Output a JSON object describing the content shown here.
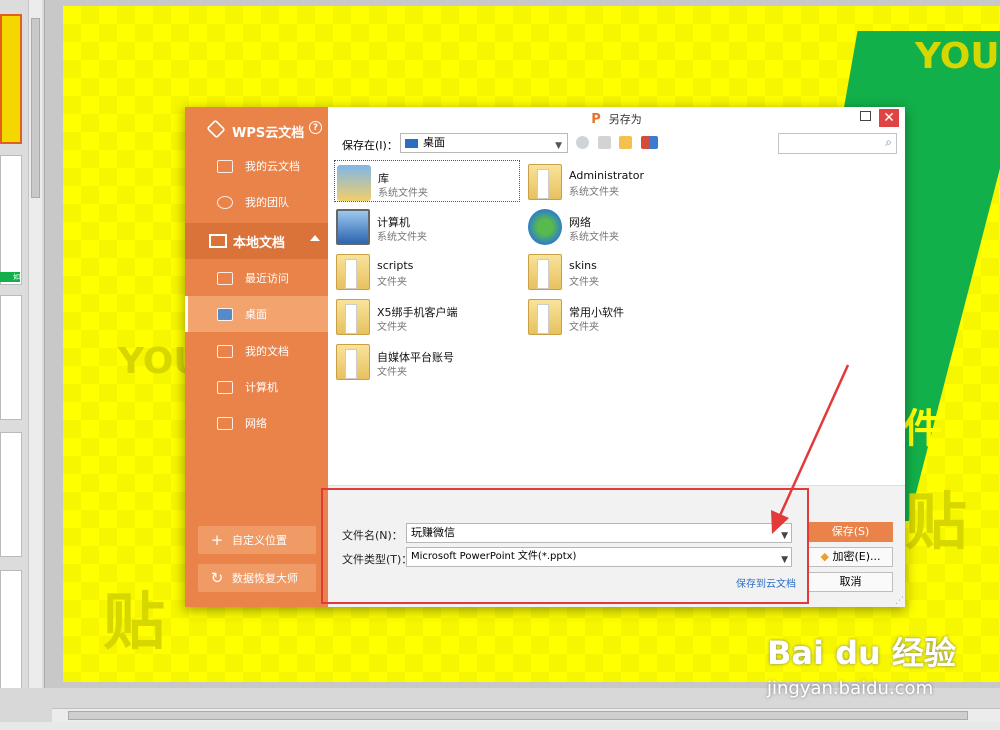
{
  "dialog": {
    "title": "另存为",
    "wps_logo": "P",
    "close_symbol": "✕",
    "sidebar": {
      "cloud_title": "WPS云文档",
      "help_symbol": "?",
      "cloud_items": [
        {
          "label": "我的云文档",
          "icon": "cloud-doc-icon"
        },
        {
          "label": "我的团队",
          "icon": "team-icon"
        }
      ],
      "local_title": "本地文档",
      "local_items": [
        {
          "label": "最近访问",
          "icon": "recent-icon"
        },
        {
          "label": "桌面",
          "icon": "desktop-icon",
          "active": true
        },
        {
          "label": "我的文档",
          "icon": "documents-icon"
        },
        {
          "label": "计算机",
          "icon": "computer-icon"
        },
        {
          "label": "网络",
          "icon": "network-icon"
        }
      ],
      "custom_location_label": "自定义位置",
      "data_recovery_label": "数据恢复大师"
    },
    "toolbar": {
      "save_in_label": "保存在(I)：",
      "location": "桌面"
    },
    "files": [
      {
        "name": "库",
        "type": "系统文件夹",
        "icon": "library-icon",
        "selected": true
      },
      {
        "name": "Administrator",
        "type": "系统文件夹",
        "icon": "user-folder-icon"
      },
      {
        "name": "计算机",
        "type": "系统文件夹",
        "icon": "computer-icon"
      },
      {
        "name": "网络",
        "type": "系统文件夹",
        "icon": "network-icon"
      },
      {
        "name": "scripts",
        "type": "文件夹",
        "icon": "folder-icon"
      },
      {
        "name": "skins",
        "type": "文件夹",
        "icon": "folder-icon"
      },
      {
        "name": "X5绑手机客户端",
        "type": "文件夹",
        "icon": "folder-icon"
      },
      {
        "name": "常用小软件",
        "type": "文件夹",
        "icon": "folder-icon"
      },
      {
        "name": "自媒体平台账号",
        "type": "文件夹",
        "icon": "folder-icon"
      }
    ],
    "form": {
      "filename_label": "文件名(N)：",
      "filename_value": "玩赚微信",
      "filetype_label": "文件类型(T)：",
      "filetype_value": "Microsoft PowerPoint 文件(*.pptx)",
      "save_to_cloud_link": "保存到云文档",
      "save_button": "保存(S)",
      "encrypt_button": "加密(E)...",
      "cancel_button": "取消"
    }
  },
  "slide": {
    "partial_text": "件",
    "watermark_left": "贴",
    "watermark_right": "贴",
    "watermark_brand": "YOU"
  },
  "thumbnails": {
    "label_fragment": "如"
  },
  "watermark": {
    "baidu_text": "Bai du 经验",
    "baidu_url": "jingyan.baidu.com"
  },
  "colors": {
    "accent_orange": "#e9834a",
    "slide_yellow": "#ffff00",
    "slide_green": "#12b04a",
    "annotation_red": "#e23a3a"
  }
}
